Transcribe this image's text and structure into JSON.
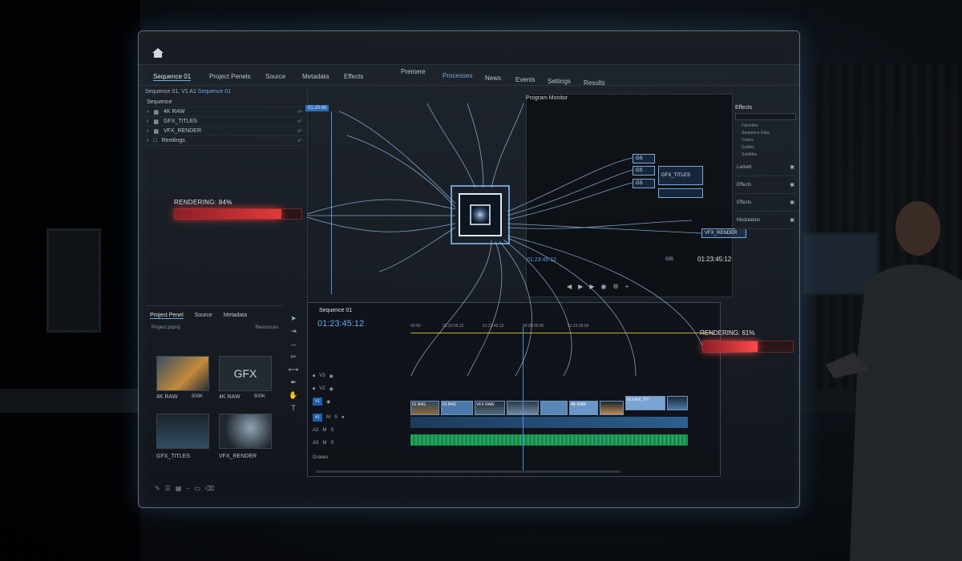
{
  "app": {
    "workspace_tabs": [
      "Premere",
      "Processes",
      "News",
      "Events",
      "Settings",
      "Results"
    ],
    "active_workspace": "Processes"
  },
  "panel_tabs": [
    "Sequence 01",
    "Project Penels",
    "Source",
    "Metadata",
    "Effects"
  ],
  "source": {
    "header": "Sequence 01, V1",
    "header_link": "Sequence 01",
    "header_mid": "A1",
    "tree_title": "Sequence",
    "items": [
      "4K RAW",
      "GFX_TITLES",
      "VFX_RENDER",
      "Renitings"
    ],
    "marker": "01:20:40"
  },
  "render_left": {
    "label": "RENDERING: 84%",
    "progress": 0.84
  },
  "program": {
    "title": "Program Monitor",
    "nodes": [
      "GS",
      "GS",
      "GS",
      "GFX_TITLES",
      "VFX_RENDER"
    ],
    "timecode": "01:23:45:12",
    "zoom": "595",
    "tc_left": "01:23:45:12"
  },
  "effects": {
    "title": "Effects",
    "tree": [
      "Favorites",
      "Sequence Data",
      "Colors",
      "Guides",
      "Subtitles"
    ],
    "rows": [
      "Lamett",
      "Effects",
      "Effects",
      "Modulation"
    ]
  },
  "project": {
    "tabs": [
      "Project Penel",
      "Source",
      "Metadata"
    ],
    "sub_left": "Project.prproj",
    "sub_right": "Resources",
    "thumbs": [
      {
        "name": "4K RAW",
        "meta": "500K"
      },
      {
        "name": "GFX",
        "label": "4K RAW",
        "meta": "500K"
      },
      {
        "name": "GFX_TITLES",
        "meta": ""
      },
      {
        "name": "VFX_RENDER",
        "meta": ""
      }
    ]
  },
  "timeline": {
    "title": "Sequence 01",
    "timecode": "01:23:45:12",
    "ruler": [
      "00:00",
      "01:23:05:12",
      "01:23:45:12",
      "00:05:00:00",
      "01:23:35:00"
    ],
    "tracks": [
      "V3",
      "V2",
      "V1",
      "A1",
      "A2",
      "A3"
    ],
    "master": "Graves",
    "clips": [
      "01 B4G",
      "01 B4G",
      "VFX RAW",
      "4K RAW",
      "01 GFX_TIT"
    ]
  },
  "render_right": {
    "label": "RENDERING: 61%",
    "progress": 0.61
  },
  "colors": {
    "accent": "#4e8fd8",
    "render": "#e23b3b",
    "audio": "#27b36a"
  }
}
